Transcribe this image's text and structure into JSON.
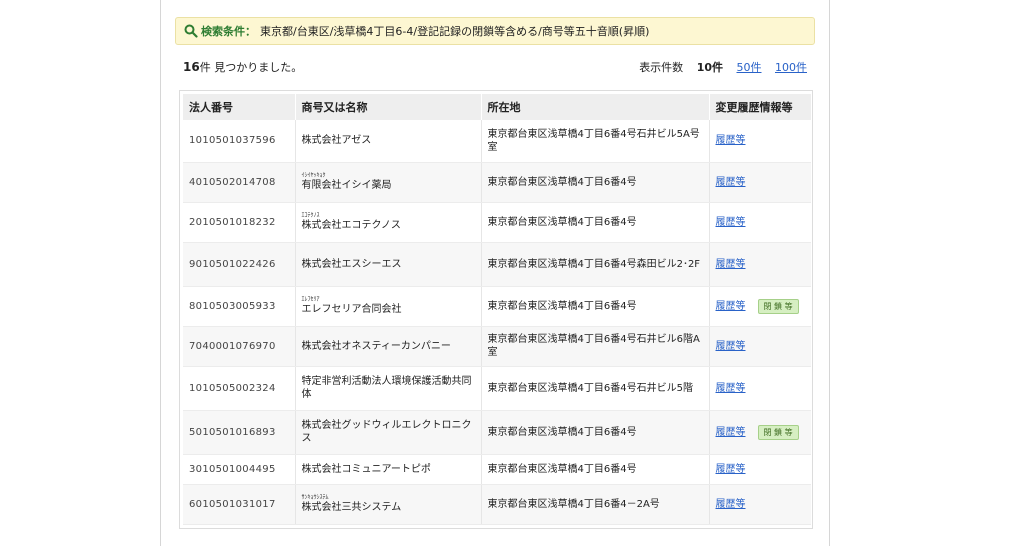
{
  "search": {
    "label": "検索条件：",
    "text": "東京都/台東区/浅草橋4丁目6-4/登記記録の閉鎖等含める/商号等五十音順(昇順)"
  },
  "results": {
    "count_num": "16",
    "count_text": "件 見つかりました。",
    "per_page_label": "表示件数",
    "per_page_current": "10件",
    "per_page_50": "50件",
    "per_page_100": "100件"
  },
  "table": {
    "headers": [
      "法人番号",
      "商号又は名称",
      "所在地",
      "変更履歴情報等"
    ],
    "rows": [
      {
        "number": "1010501037596",
        "kana": "",
        "name": "株式会社アゼス",
        "address": "東京都台東区浅草橋4丁目6番4号石井ビル5A号室",
        "history": "履歴等",
        "badge": ""
      },
      {
        "number": "4010502014708",
        "kana": "ｲｼｲﾔｯｷｮｸ",
        "name": "有限会社イシイ薬局",
        "address": "東京都台東区浅草橋4丁目6番4号",
        "history": "履歴等",
        "badge": ""
      },
      {
        "number": "2010501018232",
        "kana": "ｴｺﾃｸﾉｽ",
        "name": "株式会社エコテクノス",
        "address": "東京都台東区浅草橋4丁目6番4号",
        "history": "履歴等",
        "badge": ""
      },
      {
        "number": "9010501022426",
        "kana": "",
        "name": "株式会社エスシーエス",
        "address": "東京都台東区浅草橋4丁目6番4号森田ビル2･2F",
        "history": "履歴等",
        "badge": ""
      },
      {
        "number": "8010503005933",
        "kana": "ｴﾚﾌｾﾘｱ",
        "name": "エレフセリア合同会社",
        "address": "東京都台東区浅草橋4丁目6番4号",
        "history": "履歴等",
        "badge": "閉 鎖 等"
      },
      {
        "number": "7040001076970",
        "kana": "",
        "name": "株式会社オネスティーカンパニー",
        "address": "東京都台東区浅草橋4丁目6番4号石井ビル6階A室",
        "history": "履歴等",
        "badge": ""
      },
      {
        "number": "1010505002324",
        "kana": "",
        "name": "特定非営利活動法人環境保護活動共同体",
        "address": "東京都台東区浅草橋4丁目6番4号石井ビル5階",
        "history": "履歴等",
        "badge": ""
      },
      {
        "number": "5010501016893",
        "kana": "",
        "name": "株式会社グッドウィルエレクトロニクス",
        "address": "東京都台東区浅草橋4丁目6番4号",
        "history": "履歴等",
        "badge": "閉 鎖 等"
      },
      {
        "number": "3010501004495",
        "kana": "",
        "name": "株式会社コミュニアートピポ",
        "address": "東京都台東区浅草橋4丁目6番4号",
        "history": "履歴等",
        "badge": ""
      },
      {
        "number": "6010501031017",
        "kana": "ｻﾝｷｮｳｼｽﾃﾑ",
        "name": "株式会社三共システム",
        "address": "東京都台東区浅草橋4丁目6番4－2A号",
        "history": "履歴等",
        "badge": ""
      }
    ]
  },
  "colors": {
    "link": "#2962c8",
    "search_bg": "#fdf7d2",
    "search_label": "#2e7d32",
    "badge_bg": "#d6efc2"
  }
}
